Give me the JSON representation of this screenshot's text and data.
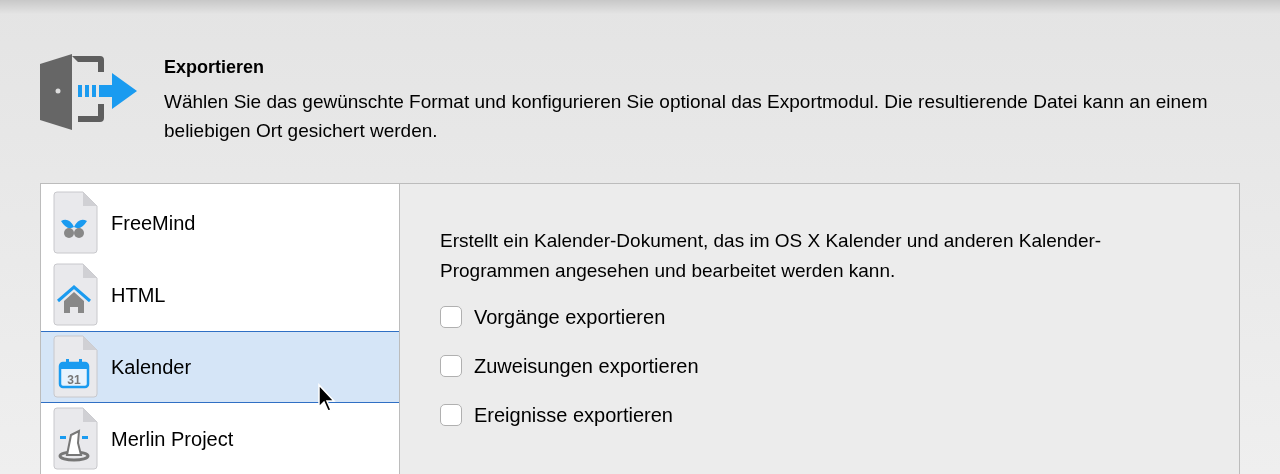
{
  "header": {
    "title": "Exportieren",
    "description": "Wählen Sie das gewünschte Format und konfigurieren Sie optional das Exportmodul. Die resultierende Datei kann an einem beliebigen Ort gesichert werden."
  },
  "formats": [
    {
      "label": "FreeMind",
      "kind": "butterfly",
      "selected": false
    },
    {
      "label": "HTML",
      "kind": "house",
      "selected": false
    },
    {
      "label": "Kalender",
      "kind": "calendar",
      "icon_label": "31",
      "selected": true
    },
    {
      "label": "Merlin Project",
      "kind": "hat",
      "selected": false
    }
  ],
  "options": {
    "description": "Erstellt ein Kalender-Dokument, das im OS X Kalender und anderen Kalender-Programmen angesehen und bearbeitet werden kann.",
    "checkboxes": [
      {
        "label": "Vorgänge exportieren",
        "checked": false
      },
      {
        "label": "Zuweisungen exportieren",
        "checked": false
      },
      {
        "label": "Ereignisse exportieren",
        "checked": false
      }
    ]
  }
}
